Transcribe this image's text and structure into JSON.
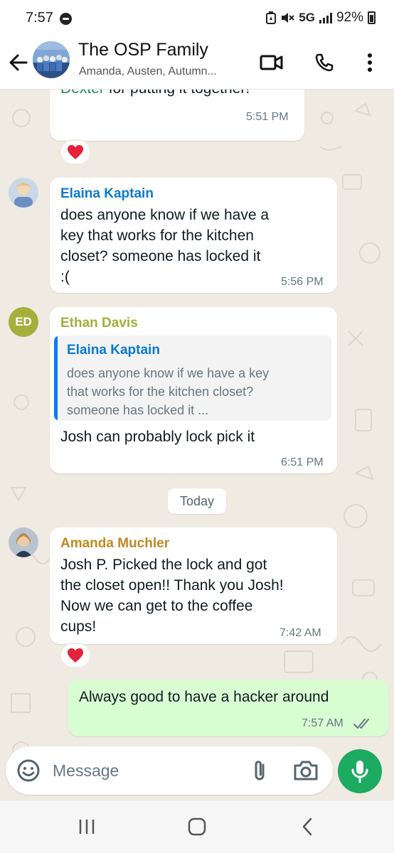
{
  "status_bar": {
    "time": "7:57",
    "network": "5G",
    "battery": "92%"
  },
  "header": {
    "title": "The OSP Family",
    "subtitle": "Amanda, Austen, Autumn..."
  },
  "messages": [
    {
      "text_parts": [
        "Dexter",
        " for putting it together!"
      ],
      "mention_color": "#1c8a55",
      "time": "5:51 PM",
      "reaction": "heart"
    },
    {
      "sender": "Elaina Kaptain",
      "sender_color": "#0b79d0",
      "lines": [
        "does anyone know if we have a",
        "key that works for the kitchen",
        "closet? someone has locked it",
        ":("
      ],
      "time": "5:56 PM"
    },
    {
      "sender": "Ethan Davis",
      "sender_color": "#a1b03a",
      "avatar_initials": "ED",
      "quote": {
        "sender": "Elaina Kaptain",
        "lines": [
          "does anyone know if we have a key",
          "that works for the kitchen closet?",
          "someone has locked it ..."
        ]
      },
      "text": "Josh can probably lock pick it",
      "time": "6:51 PM"
    },
    {
      "sender": "Amanda Muchler",
      "sender_color": "#c08a1e",
      "lines": [
        "Josh P. Picked the lock and got",
        "the closet open!! Thank you Josh!",
        "Now we can get to the coffee",
        "cups!"
      ],
      "time": "7:42 AM",
      "reaction": "heart"
    },
    {
      "text": "Always good to have a hacker around",
      "time": "7:57 AM",
      "status": "read"
    }
  ],
  "date_divider": "Today",
  "composer": {
    "placeholder": "Message"
  },
  "icons": [
    "back-arrow-icon",
    "video-call-icon",
    "phone-icon",
    "more-icon",
    "emoji-icon",
    "attach-icon",
    "camera-icon",
    "mic-icon",
    "heart-icon",
    "double-check-icon",
    "recents-icon",
    "home-icon",
    "back-icon"
  ],
  "colors": {
    "outgoing_bubble": "#d9fdd3",
    "incoming_bubble": "#ffffff",
    "chat_background": "#efeae2",
    "mic_button": "#1daa61",
    "read_ticks": "#667781"
  }
}
